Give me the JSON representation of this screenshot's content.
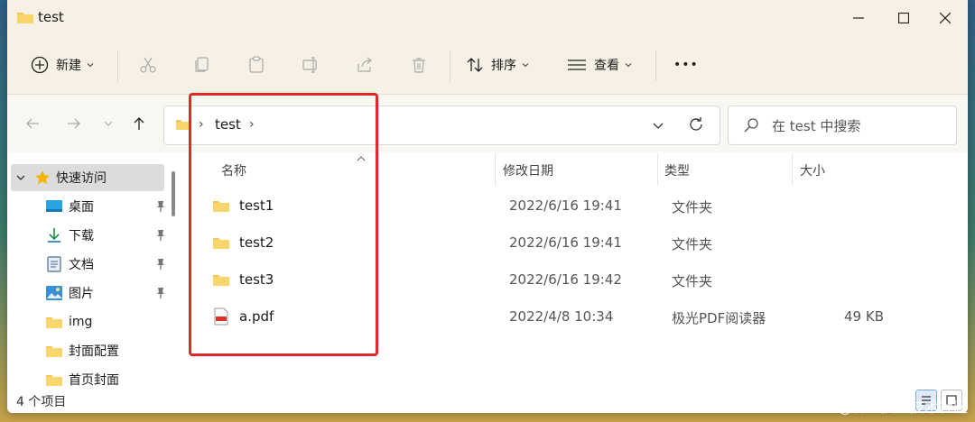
{
  "window": {
    "title": "test"
  },
  "toolbar": {
    "new_label": "新建",
    "sort_label": "排序",
    "view_label": "查看",
    "more_label": "•••"
  },
  "address": {
    "crumb": "test",
    "separator": "›"
  },
  "search": {
    "placeholder": "在 test 中搜索"
  },
  "sidebar": {
    "quick_access": "快速访问",
    "items": [
      {
        "label": "桌面",
        "icon": "desktop-icon",
        "pinned": true
      },
      {
        "label": "下载",
        "icon": "download-icon",
        "pinned": true
      },
      {
        "label": "文档",
        "icon": "document-icon",
        "pinned": true
      },
      {
        "label": "图片",
        "icon": "picture-icon",
        "pinned": true
      },
      {
        "label": "img",
        "icon": "folder-icon",
        "pinned": false
      },
      {
        "label": "封面配置",
        "icon": "folder-icon",
        "pinned": false
      },
      {
        "label": "首页封面",
        "icon": "folder-icon",
        "pinned": false
      }
    ]
  },
  "columns": {
    "name": "名称",
    "modified": "修改日期",
    "type": "类型",
    "size": "大小"
  },
  "files": [
    {
      "name": "test1",
      "modified": "2022/6/16 19:41",
      "type": "文件夹",
      "size": "",
      "icon": "folder-icon"
    },
    {
      "name": "test2",
      "modified": "2022/6/16 19:41",
      "type": "文件夹",
      "size": "",
      "icon": "folder-icon"
    },
    {
      "name": "test3",
      "modified": "2022/6/16 19:42",
      "type": "文件夹",
      "size": "",
      "icon": "folder-icon"
    },
    {
      "name": "a.pdf",
      "modified": "2022/4/8 10:34",
      "type": "极光PDF阅读器",
      "size": "49 KB",
      "icon": "pdf-icon"
    }
  ],
  "status": {
    "count": "4 个项目"
  },
  "watermark": "@稀土掘金技术社区",
  "colors": {
    "accent": "#0067c0",
    "highlight": "#e0272a",
    "folder": "#f2c94c"
  }
}
